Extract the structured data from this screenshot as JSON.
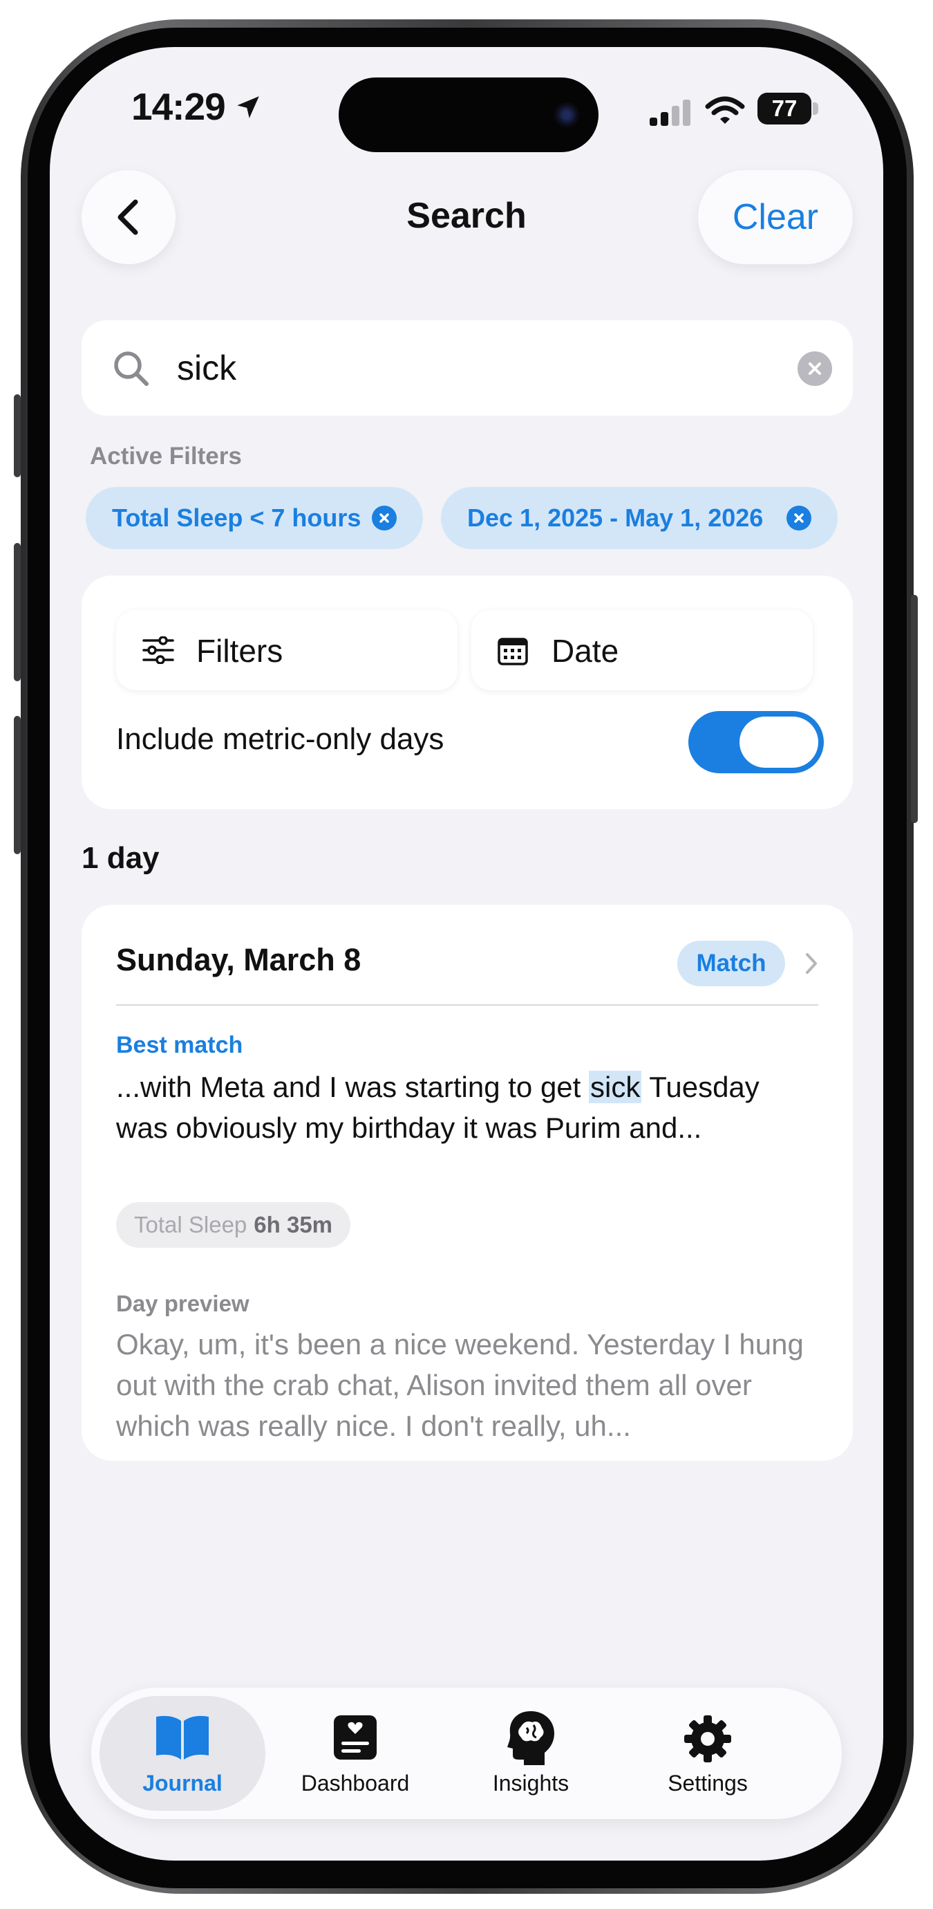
{
  "status_bar": {
    "time": "14:29",
    "battery": "77"
  },
  "header": {
    "title": "Search",
    "clear_label": "Clear"
  },
  "search": {
    "query": "sick"
  },
  "filters": {
    "section_label": "Active Filters",
    "chips": [
      "Total Sleep < 7 hours",
      "Dec 1, 2025 - May 1, 2026"
    ],
    "filters_button": "Filters",
    "date_button": "Date",
    "toggle_label": "Include metric-only days",
    "toggle_on": true
  },
  "results": {
    "count_label": "1 day",
    "items": [
      {
        "date": "Sunday, March 8",
        "badge": "Match",
        "best_match_label": "Best match",
        "snippet_before": "...with Meta and I was starting to get ",
        "snippet_highlight": "sick",
        "snippet_after": " Tuesday was obviously my birthday it was Purim and...",
        "metric_label": "Total Sleep",
        "metric_value": "6h 35m",
        "preview_label": "Day preview",
        "preview": "Okay, um, it's been a nice weekend. Yesterday I hung out with the crab chat, Alison invited them all over which was really nice. I don't really, uh..."
      }
    ]
  },
  "tabbar": {
    "tabs": [
      {
        "label": "Journal",
        "icon": "book-icon",
        "active": true
      },
      {
        "label": "Dashboard",
        "icon": "dashboard-icon",
        "active": false
      },
      {
        "label": "Insights",
        "icon": "brain-head-icon",
        "active": false
      },
      {
        "label": "Settings",
        "icon": "gear-icon",
        "active": false
      }
    ]
  },
  "colors": {
    "accent": "#1a7fe0",
    "chip_bg": "#d3e6f8",
    "background": "#f2f2f7"
  }
}
